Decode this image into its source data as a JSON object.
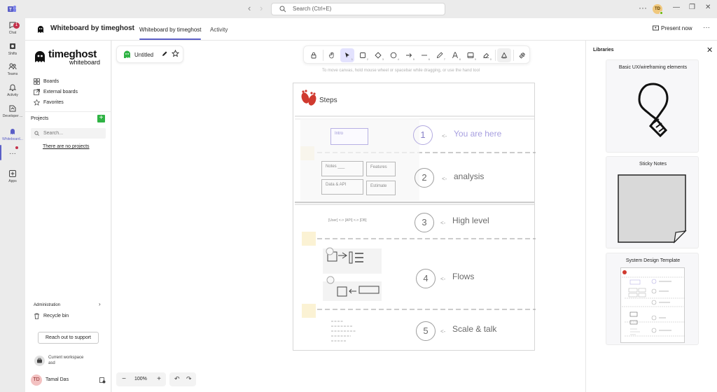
{
  "titlebar": {
    "search_placeholder": "Search (Ctrl+E)",
    "more": "···",
    "avatar_initials": "TD",
    "back_arrow": "‹",
    "forward_arrow": "›",
    "minimize": "—",
    "maximize": "❐",
    "close": "✕"
  },
  "rail": {
    "chat": "Chat",
    "chat_badge": "1",
    "shifts": "Shifts",
    "teams": "Teams",
    "activity": "Activity",
    "developer": "Developer ...",
    "whiteboard": "Whiteboard...",
    "more": "···",
    "apps": "Apps"
  },
  "header": {
    "title": "Whiteboard by timeghost",
    "tabs": [
      {
        "label": "Whiteboard by timeghost",
        "active": true
      },
      {
        "label": "Activity",
        "active": false
      }
    ],
    "present": "Present now",
    "more": "···"
  },
  "sidebar": {
    "logo_main": "timeghost",
    "logo_sub": "whiteboard",
    "nav": [
      "Boards",
      "External boards",
      "Favorites"
    ],
    "projects_label": "Projects",
    "add_label": "+",
    "search_placeholder": "Search...",
    "no_projects": "There are no projects",
    "admin_label": "Administration",
    "admin_chevron": "›",
    "recycle_bin": "Recycle bin",
    "support": "Reach out to support",
    "workspace_label": "Current workspace",
    "workspace_name": "asd",
    "user_initials": "TD",
    "user_name": "Tamal Das"
  },
  "canvas": {
    "file_name": "Untitled",
    "hint": "To move canvas, hold mouse wheel or spacebar while dragging, or use the hand tool",
    "tools": [
      {
        "icon": "lock-icon",
        "num": ""
      },
      {
        "icon": "hand-icon",
        "num": ""
      },
      {
        "icon": "cursor-icon",
        "num": "1",
        "active": true
      },
      {
        "icon": "rectangle-icon",
        "num": "2"
      },
      {
        "icon": "diamond-icon",
        "num": "3"
      },
      {
        "icon": "circle-icon",
        "num": "4"
      },
      {
        "icon": "arrow-icon",
        "num": "5"
      },
      {
        "icon": "line-icon",
        "num": "6"
      },
      {
        "icon": "pencil-icon",
        "num": "7"
      },
      {
        "icon": "text-icon",
        "num": "8"
      },
      {
        "icon": "image-icon",
        "num": "9"
      },
      {
        "icon": "eraser-icon",
        "num": "0"
      },
      {
        "icon": "shapes-icon",
        "num": ""
      },
      {
        "icon": "library-icon",
        "num": ""
      }
    ],
    "zoom": "100%",
    "zoom_minus": "−",
    "zoom_plus": "+",
    "undo": "↶",
    "redo": "↷",
    "board": {
      "title": "Steps",
      "steps": [
        {
          "num": "1",
          "label": "You are here"
        },
        {
          "num": "2",
          "label": "analysis"
        },
        {
          "num": "3",
          "label": "High level"
        },
        {
          "num": "4",
          "label": "Flows"
        },
        {
          "num": "5",
          "label": "Scale & talk"
        }
      ],
      "arrow": "<-",
      "intro": "Intro",
      "notes": "Notes ___",
      "features": "Features",
      "data_api": "Data & API",
      "estimate": "Estimate",
      "arch": "[User] <-> [API] <-> [DB]"
    }
  },
  "libraries": {
    "title": "Libraries",
    "close": "✕",
    "cards": [
      {
        "title": "Basic UX/wireframing elements"
      },
      {
        "title": "Sticky Notes"
      },
      {
        "title": "System Design Template"
      }
    ]
  },
  "colors": {
    "accent": "#5b5fc7",
    "add_green": "#2fb344",
    "tool_active": "#e3e2fe",
    "step_highlight": "#a79fe0"
  }
}
